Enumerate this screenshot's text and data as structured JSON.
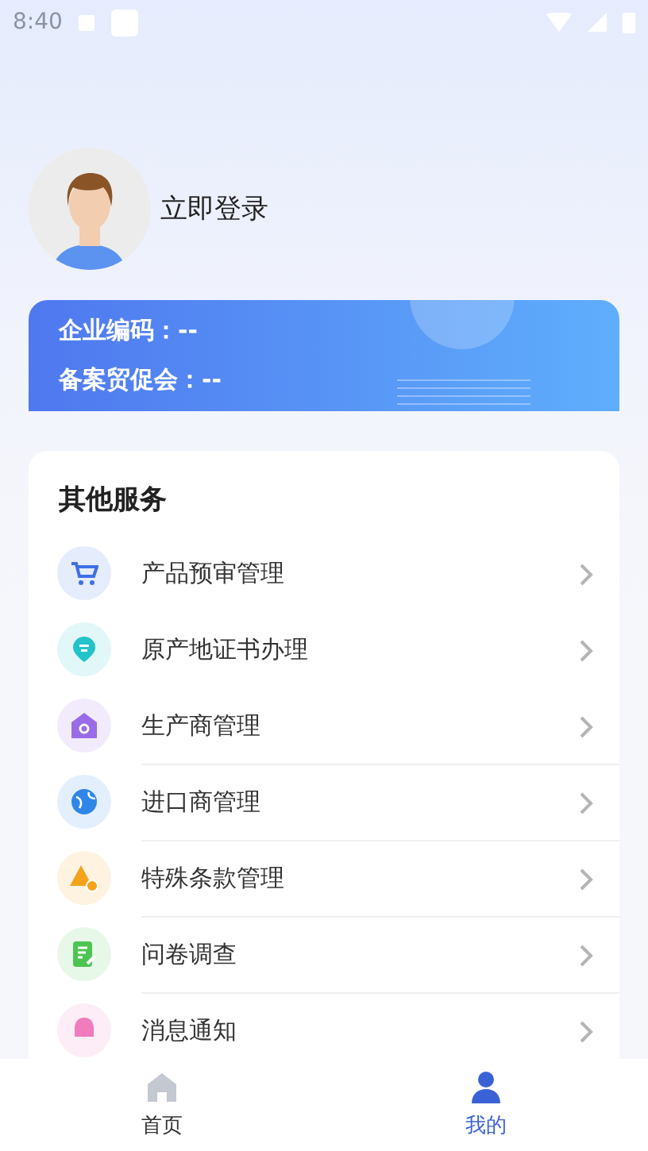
{
  "status_bar": {
    "time": "8:40"
  },
  "profile": {
    "login_label": "立即登录"
  },
  "company_card": {
    "lines": [
      "企业编码：--",
      "备案贸促会：--"
    ]
  },
  "services": {
    "title": "其他服务",
    "items": [
      {
        "label": "产品预审管理",
        "kind": "cart",
        "color": "#3f6fe8",
        "divider": false
      },
      {
        "label": "原产地证书办理",
        "kind": "pin",
        "color": "#22c3c9",
        "divider": false
      },
      {
        "label": "生产商管理",
        "kind": "house",
        "color": "#9a6be6",
        "divider": false
      },
      {
        "label": "进口商管理",
        "kind": "globe",
        "color": "#2f86e8",
        "divider": true
      },
      {
        "label": "特殊条款管理",
        "kind": "triangle",
        "color": "#f3a21a",
        "divider": true
      },
      {
        "label": "问卷调查",
        "kind": "note",
        "color": "#4cc451",
        "divider": true
      },
      {
        "label": "消息通知",
        "kind": "bell",
        "color": "#f07bbd",
        "divider": true
      }
    ]
  },
  "tab_bar": {
    "tabs": [
      {
        "label": "首页",
        "kind": "home",
        "selected": false
      },
      {
        "label": "我的",
        "kind": "user",
        "selected": true
      }
    ]
  }
}
